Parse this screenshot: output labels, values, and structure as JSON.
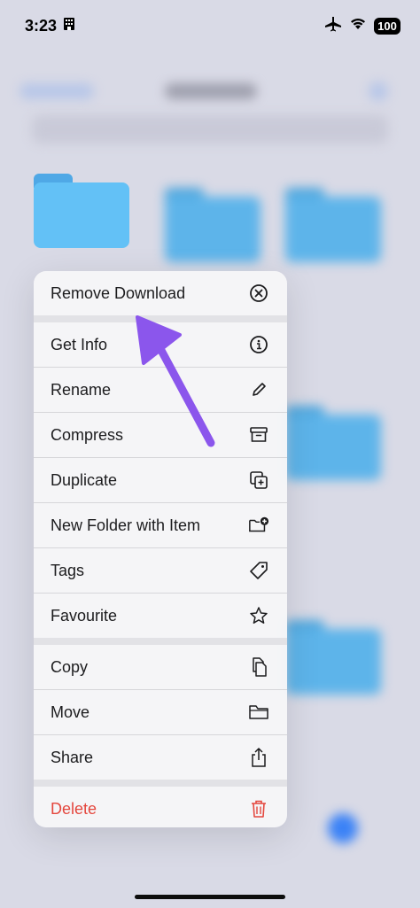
{
  "status_bar": {
    "time": "3:23",
    "battery": "100"
  },
  "menu": {
    "items": [
      {
        "label": "Remove Download",
        "icon": "remove-download-icon"
      },
      {
        "label": "Get Info",
        "icon": "info-icon"
      },
      {
        "label": "Rename",
        "icon": "pencil-icon"
      },
      {
        "label": "Compress",
        "icon": "archive-box-icon"
      },
      {
        "label": "Duplicate",
        "icon": "duplicate-icon"
      },
      {
        "label": "New Folder with Item",
        "icon": "new-folder-icon"
      },
      {
        "label": "Tags",
        "icon": "tag-icon"
      },
      {
        "label": "Favourite",
        "icon": "star-icon"
      },
      {
        "label": "Copy",
        "icon": "copy-icon"
      },
      {
        "label": "Move",
        "icon": "folder-icon"
      },
      {
        "label": "Share",
        "icon": "share-icon"
      },
      {
        "label": "Delete",
        "icon": "trash-icon"
      }
    ]
  },
  "colors": {
    "folder_blue": "#5fb9f2",
    "delete_red": "#e4473e",
    "arrow_purple": "#8b56ec"
  }
}
